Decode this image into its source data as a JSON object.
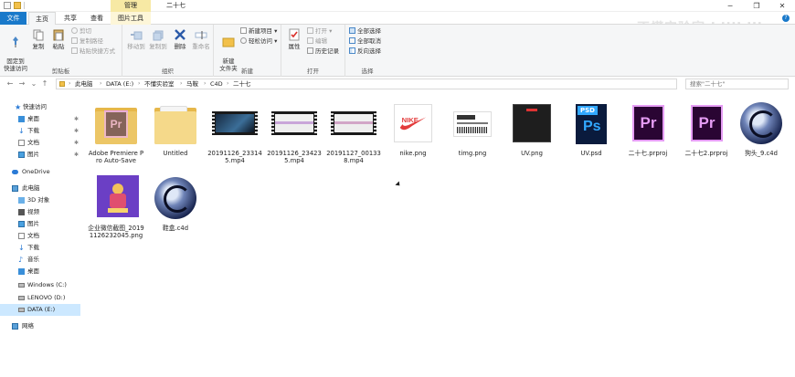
{
  "window": {
    "manage_tab": "管理",
    "title": "二十七",
    "minimize": "─",
    "maximize": "❐",
    "close": "✕",
    "watermark": "不懂实验室 bilibili"
  },
  "tabs": [
    {
      "label": "文件"
    },
    {
      "label": "主页"
    },
    {
      "label": "共享"
    },
    {
      "label": "查看"
    },
    {
      "label": "图片工具"
    }
  ],
  "ribbon": {
    "clipboard": {
      "label": "剪贴板",
      "pin": "固定到\n快速访问",
      "copy": "复制",
      "paste": "粘贴",
      "cut": "剪切",
      "copy_path": "复制路径",
      "paste_shortcut": "粘贴快捷方式"
    },
    "organize": {
      "label": "组织",
      "move_to": "移动到",
      "copy_to": "复制到",
      "delete": "删除",
      "rename": "重命名"
    },
    "new": {
      "label": "新建",
      "new_folder": "新建\n文件夹",
      "new_item": "新建项目 ▾",
      "easy_access": "轻松访问 ▾"
    },
    "open": {
      "label": "打开",
      "properties": "属性",
      "open": "打开 ▾",
      "edit": "编辑",
      "history": "历史记录"
    },
    "select": {
      "label": "选择",
      "select_all": "全部选择",
      "select_none": "全部取消",
      "invert": "反向选择"
    }
  },
  "address": {
    "back": "←",
    "forward": "→",
    "recent": "⌄",
    "up": "↑",
    "crumbs": [
      "此电脑",
      "DATA (E:)",
      "不懂实验室",
      "马鞍",
      "C4D",
      "二十七"
    ],
    "search_placeholder": "搜索\"二十七\""
  },
  "nav": {
    "quick_access": "快速访问",
    "desktop": "桌面",
    "downloads": "下载",
    "documents": "文档",
    "pictures": "图片",
    "onedrive": "OneDrive",
    "this_pc": "此电脑",
    "objects3d": "3D 对象",
    "videos": "视频",
    "pictures2": "图片",
    "documents2": "文档",
    "downloads2": "下载",
    "music": "音乐",
    "desktop2": "桌面",
    "drive_c": "Windows (C:)",
    "drive_d": "LENOVO (D:)",
    "drive_e": "DATA (E:)",
    "network": "网络"
  },
  "files": [
    {
      "name": "Adobe Premiere Pro Auto-Save",
      "icon": "folder-premiere-icon"
    },
    {
      "name": "Untitled",
      "icon": "folder-icon"
    },
    {
      "name": "20191126_233145.mp4",
      "icon": "video-icon"
    },
    {
      "name": "20191126_234235.mp4",
      "icon": "video-icon"
    },
    {
      "name": "20191127_001338.mp4",
      "icon": "video-icon"
    },
    {
      "name": "nike.png",
      "icon": "nike-image-icon"
    },
    {
      "name": "timg.png",
      "icon": "label-image-icon"
    },
    {
      "name": "UV.png",
      "icon": "uv-image-icon"
    },
    {
      "name": "UV.psd",
      "icon": "psd-icon",
      "tag": "PSD",
      "glyph": "Ps"
    },
    {
      "name": "二十七.prproj",
      "icon": "premiere-project-icon",
      "glyph": "Pr"
    },
    {
      "name": "二十七2.prproj",
      "icon": "premiere-project-icon",
      "glyph": "Pr"
    },
    {
      "name": "狗头_9.c4d",
      "icon": "cinema4d-icon"
    },
    {
      "name": "企业微信截图_20191126232045.png",
      "icon": "screenshot-image-icon"
    },
    {
      "name": "鞋盒.c4d",
      "icon": "cinema4d-icon"
    }
  ],
  "colors": {
    "file_tab": "#1979ca",
    "manage_tab": "#f7e9a4",
    "selection": "#cce8ff",
    "premiere": "#e59cf4",
    "photoshop": "#31a8ff"
  }
}
